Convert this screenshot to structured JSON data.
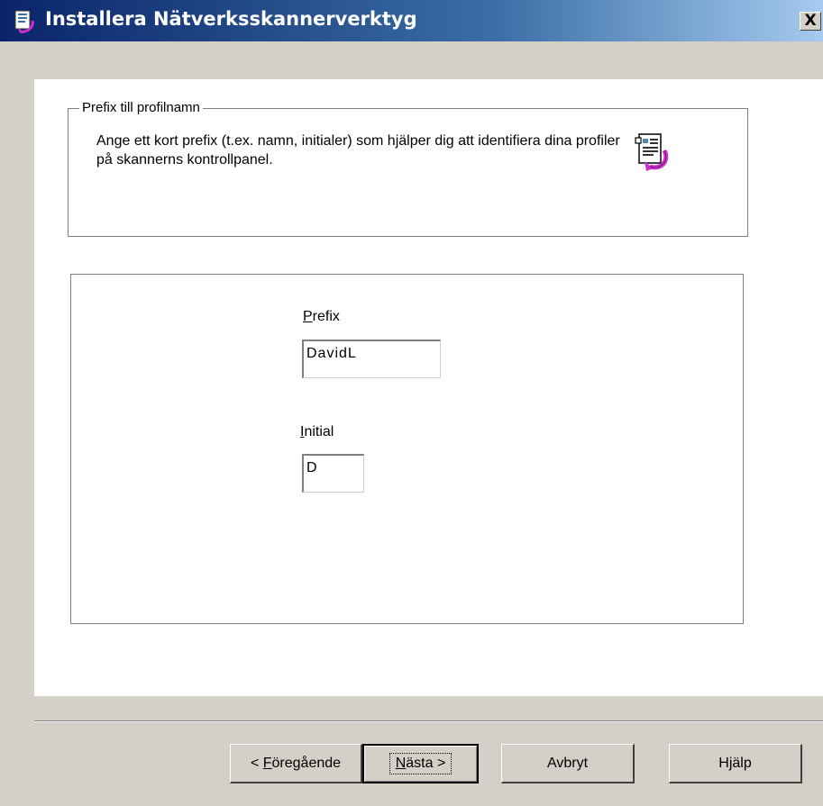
{
  "window": {
    "title": "Installera Nätverksskannerverktyg",
    "close_label": "X",
    "title_icon": "installer-icon"
  },
  "group": {
    "legend": "Prefix till profilnamn",
    "description": "Ange ett kort prefix (t.ex. namn, initialer) som hjälper dig att identifiera dina profiler på skannerns kontrollpanel.",
    "icon": "profile-document-icon"
  },
  "fields": {
    "prefix": {
      "label_mnemonic": "P",
      "label_rest": "refix",
      "value": "DavidL"
    },
    "initial": {
      "label_mnemonic": "I",
      "label_rest": "nitial",
      "value": "D"
    }
  },
  "buttons": {
    "back": {
      "prefix": "< ",
      "mnemonic": "F",
      "rest": "öregående"
    },
    "next": {
      "mnemonic": "N",
      "rest": "ästa >"
    },
    "cancel": {
      "label": "Avbryt"
    },
    "help": {
      "label": "Hjälp"
    }
  },
  "colors": {
    "titlebar_start": "#0a246a",
    "titlebar_end": "#a6caf0",
    "dialog_bg": "#d4d0c8",
    "accent_magenta": "#cc33cc"
  }
}
